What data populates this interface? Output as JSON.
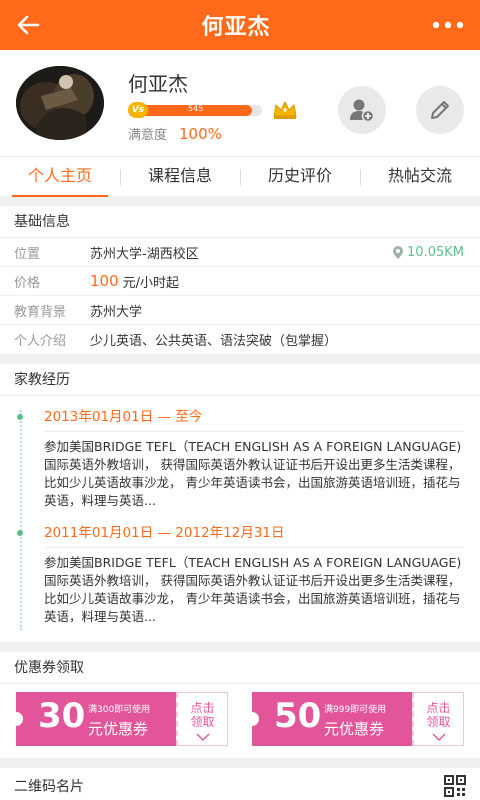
{
  "header": {
    "title": "何亚杰"
  },
  "profile": {
    "name": "何亚杰",
    "level_badge": "Vs",
    "score": "545",
    "progress_fraction": 0.92,
    "satisfaction_label": "满意度",
    "satisfaction_value": "100%"
  },
  "tabs": [
    {
      "label": "个人主页"
    },
    {
      "label": "课程信息"
    },
    {
      "label": "历史评价"
    },
    {
      "label": "热帖交流"
    }
  ],
  "basic_info": {
    "title": "基础信息",
    "location_label": "位置",
    "location_value": "苏州大学-湖西校区",
    "distance": "10.05KM",
    "price_label": "价格",
    "price_value": "100",
    "price_unit": "元/小时起",
    "education_label": "教育背景",
    "education_value": "苏州大学",
    "intro_label": "个人介绍",
    "intro_value": "少儿英语、公共英语、语法突破（包掌握）"
  },
  "experience": {
    "title": "家教经历",
    "items": [
      {
        "date": "2013年01月01日 — 至今",
        "text": "参加美国BRIDGE TEFL（TEACH ENGLISH AS A FOREIGN LANGUAGE)国际英语外教培训，  获得国际英语外教认证证书后开设出更多生活类课程，比如少儿英语故事沙龙，  青少年英语读书会，出国旅游英语培训班，插花与英语，料理与英语..."
      },
      {
        "date": "2011年01月01日 — 2012年12月31日",
        "text": "参加美国BRIDGE TEFL（TEACH ENGLISH AS A FOREIGN LANGUAGE)国际英语外教培训，  获得国际英语外教认证证书后开设出更多生活类课程，比如少儿英语故事沙龙，  青少年英语读书会，出国旅游英语培训班，插花与英语，料理与英语..."
      }
    ]
  },
  "coupons": {
    "title": "优惠券领取",
    "items": [
      {
        "amount": "30",
        "condition": "满300即可使用",
        "type": "元优惠券",
        "action_line1": "点击",
        "action_line2": "领取"
      },
      {
        "amount": "50",
        "condition": "满999即可使用",
        "type": "元优惠券",
        "action_line1": "点击",
        "action_line2": "领取"
      }
    ]
  },
  "qr": {
    "title": "二维码名片"
  },
  "colors": {
    "accent": "#ff6a1a",
    "coupon": "#e3559a",
    "green": "#5cc08a"
  }
}
